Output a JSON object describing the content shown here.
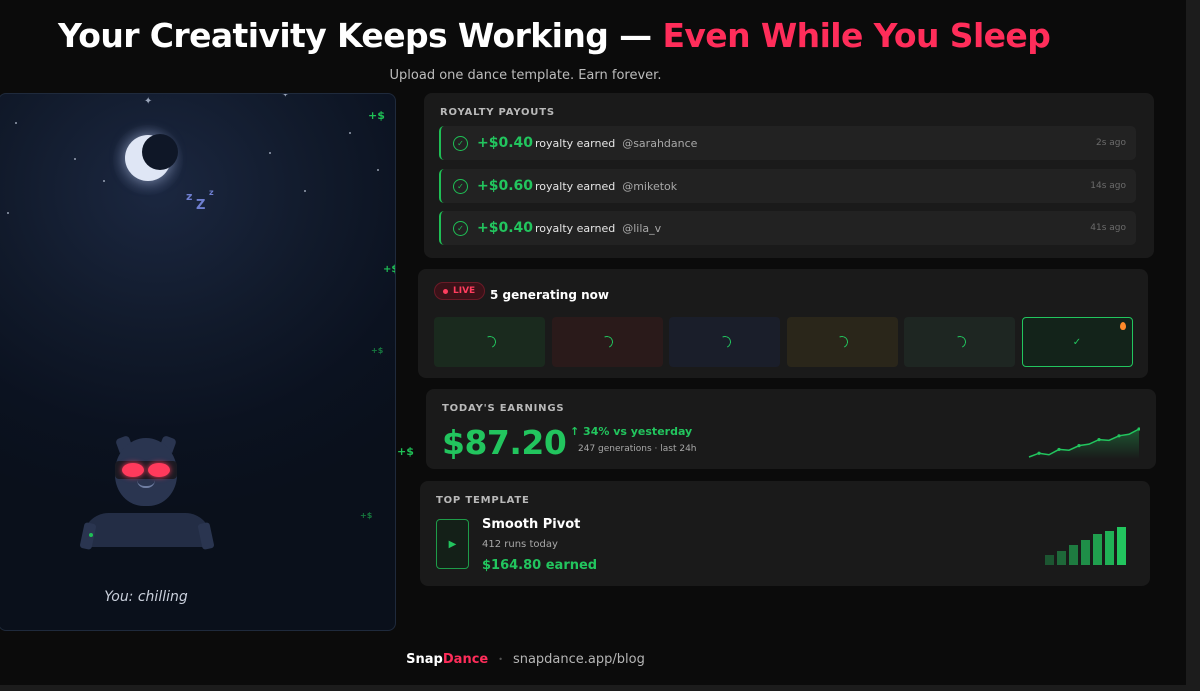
{
  "header": {
    "title_main": "Your Creativity Keeps Working — ",
    "title_accent": "Even While You Sleep",
    "subtitle": "Upload one dance template. Earn forever."
  },
  "sleep_panel": {
    "zzz": [
      "z",
      "Z",
      "z"
    ],
    "money_marks": [
      "+$",
      "+$",
      "+$",
      "+$",
      "+$",
      "+$"
    ],
    "status": "You: chilling"
  },
  "payouts": {
    "label": "ROYALTY PAYOUTS",
    "rows": [
      {
        "amount": "+$0.40",
        "text": "royalty earned",
        "user": "@sarahdance",
        "time": "2s ago"
      },
      {
        "amount": "+$0.60",
        "text": "royalty earned",
        "user": "@miketok",
        "time": "14s ago"
      },
      {
        "amount": "+$0.40",
        "text": "royalty earned",
        "user": "@lila_v",
        "time": "41s ago"
      }
    ]
  },
  "live": {
    "badge": "LIVE",
    "count_text": "5 generating now",
    "tiles": [
      {
        "state": "generating",
        "tint": "#1a2a1e"
      },
      {
        "state": "generating",
        "tint": "#2a1a1a"
      },
      {
        "state": "generating",
        "tint": "#1a1e2a"
      },
      {
        "state": "generating",
        "tint": "#2a261a"
      },
      {
        "state": "generating",
        "tint": "#1e2622"
      },
      {
        "state": "done",
        "tint": "#13231a"
      }
    ]
  },
  "earnings": {
    "label": "TODAY'S EARNINGS",
    "amount": "$87.20",
    "delta": "↑ 34% vs yesterday",
    "sub": "247 generations · last 24h",
    "trend": [
      3,
      4,
      3.6,
      5,
      4.8,
      6,
      6.4,
      7.6,
      7.4,
      8.6,
      9,
      10.4
    ]
  },
  "top_template": {
    "label": "TOP TEMPLATE",
    "name": "Smooth Pivot",
    "runs": "412 runs today",
    "earned": "$164.80 earned",
    "bar_levels": [
      0.25,
      0.35,
      0.5,
      0.62,
      0.78,
      0.85,
      0.95
    ]
  },
  "footer": {
    "brand_a": "Snap",
    "brand_b": "Dance",
    "sep": "•",
    "link": "snapdance.app/blog"
  },
  "colors": {
    "accent_red": "#ff2d5a",
    "accent_green": "#22c55e",
    "background": "#0b0b0b",
    "card": "#1a1a1a"
  }
}
